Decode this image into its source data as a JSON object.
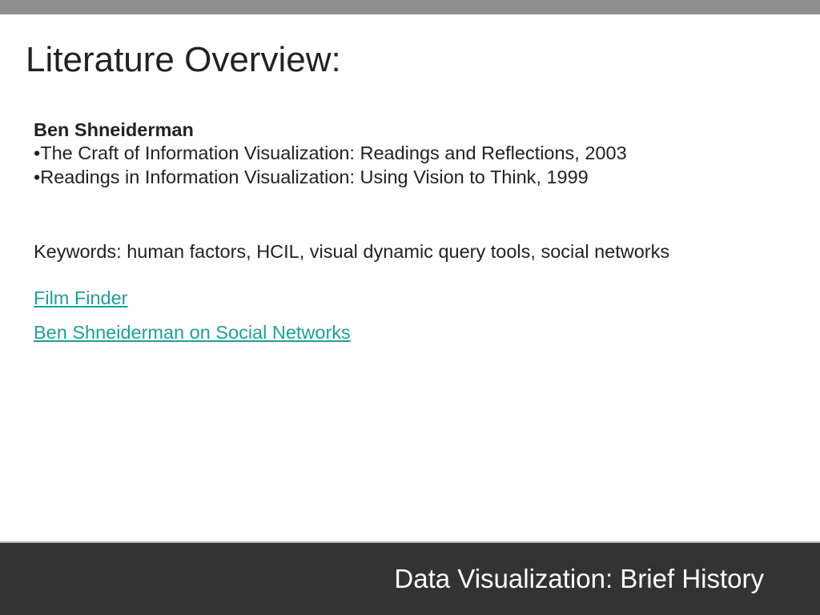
{
  "slide": {
    "title": "Literature Overview:",
    "author": "Ben Shneiderman",
    "bullets": [
      "The Craft of Information Visualization: Readings and Reflections, 2003",
      "Readings in Information Visualization: Using Vision to Think, 1999"
    ],
    "keywords": "Keywords: human factors, HCIL, visual dynamic query tools, social networks",
    "links": [
      "Film Finder",
      "Ben Shneiderman on Social Networks"
    ],
    "footer": "Data Visualization: Brief History"
  }
}
